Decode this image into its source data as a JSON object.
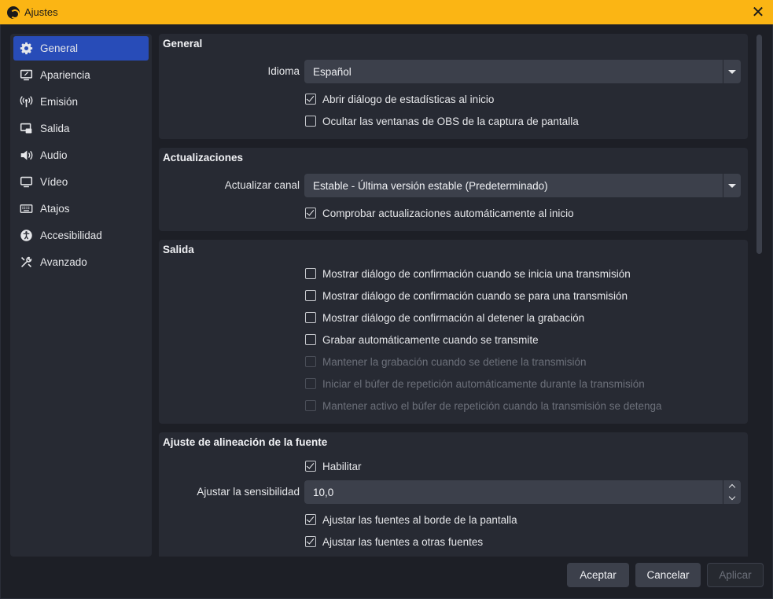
{
  "window": {
    "title": "Ajustes",
    "close_symbol": "✕"
  },
  "sidebar": {
    "items": [
      {
        "label": "General",
        "icon": "gear-icon",
        "active": true
      },
      {
        "label": "Apariencia",
        "icon": "appearance-icon"
      },
      {
        "label": "Emisión",
        "icon": "broadcast-icon"
      },
      {
        "label": "Salida",
        "icon": "output-icon"
      },
      {
        "label": "Audio",
        "icon": "speaker-icon"
      },
      {
        "label": "Vídeo",
        "icon": "monitor-icon"
      },
      {
        "label": "Atajos",
        "icon": "keyboard-icon"
      },
      {
        "label": "Accesibilidad",
        "icon": "accessibility-icon"
      },
      {
        "label": "Avanzado",
        "icon": "tools-icon"
      }
    ]
  },
  "general": {
    "title": "General",
    "language_label": "Idioma",
    "language_value": "Español",
    "checks": [
      {
        "label": "Abrir diálogo de estadísticas al inicio",
        "checked": true
      },
      {
        "label": "Ocultar las ventanas de OBS de la captura de pantalla",
        "checked": false
      }
    ]
  },
  "updates": {
    "title": "Actualizaciones",
    "channel_label": "Actualizar canal",
    "channel_value": "Estable - Última versión estable (Predeterminado)",
    "checks": [
      {
        "label": "Comprobar actualizaciones automáticamente al inicio",
        "checked": true
      }
    ]
  },
  "output": {
    "title": "Salida",
    "checks": [
      {
        "label": "Mostrar diálogo de confirmación cuando se inicia una transmisión",
        "checked": false,
        "disabled": false
      },
      {
        "label": "Mostrar diálogo de confirmación cuando se para una transmisión",
        "checked": false,
        "disabled": false
      },
      {
        "label": "Mostrar diálogo de confirmación al detener la grabación",
        "checked": false,
        "disabled": false
      },
      {
        "label": "Grabar automáticamente cuando se transmite",
        "checked": false,
        "disabled": false
      },
      {
        "label": "Mantener la grabación cuando se detiene la transmisión",
        "checked": false,
        "disabled": true
      },
      {
        "label": "Iniciar el búfer de repetición automáticamente durante la transmisión",
        "checked": false,
        "disabled": true
      },
      {
        "label": "Mantener activo el búfer de repetición cuando la transmisión se detenga",
        "checked": false,
        "disabled": true
      }
    ]
  },
  "snapping": {
    "title": "Ajuste de alineación de la fuente",
    "enable_label": "Habilitar",
    "enable_checked": true,
    "sensitivity_label": "Ajustar la sensibilidad",
    "sensitivity_value": "10,0",
    "checks": [
      {
        "label": "Ajustar las fuentes al borde de la pantalla",
        "checked": true
      },
      {
        "label": "Ajustar las fuentes a otras fuentes",
        "checked": true
      }
    ]
  },
  "footer": {
    "accept_label": "Aceptar",
    "cancel_label": "Cancelar",
    "apply_label": "Aplicar",
    "apply_disabled": true
  },
  "colors": {
    "titlebar": "#fbb514",
    "accent": "#284cb8",
    "panel": "#272a33",
    "background": "#1d1f26",
    "field": "#3c404b"
  }
}
